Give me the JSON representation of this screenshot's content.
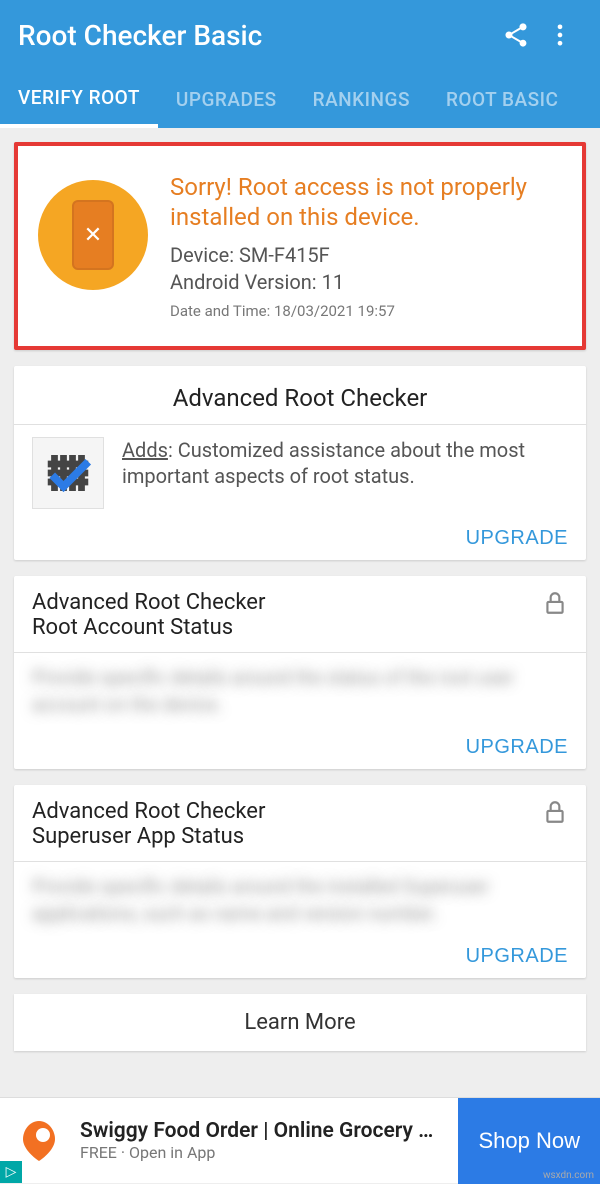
{
  "appbar": {
    "title": "Root Checker Basic"
  },
  "tabs": {
    "verify_root": "VERIFY ROOT",
    "upgrades": "UPGRADES",
    "rankings": "RANKINGS",
    "root_basics": "ROOT BASIC"
  },
  "status": {
    "headline": "Sorry! Root access is not properly installed on this device.",
    "device_label": "Device: SM-F415F",
    "android_label": "Android Version: 11",
    "datetime_label": "Date and Time: 18/03/2021 19:57"
  },
  "arc": {
    "title": "Advanced Root Checker",
    "adds_prefix": "Adds",
    "desc_rest": ": Customized assistance about the most important aspects of root status.",
    "upgrade": "UPGRADE"
  },
  "account_status": {
    "title1": "Advanced Root Checker",
    "title2": "Root Account Status",
    "blurred": "Provide specific details around the status of the root user account on the device.",
    "upgrade": "UPGRADE"
  },
  "superuser_status": {
    "title1": "Advanced Root Checker",
    "title2": "Superuser App Status",
    "blurred": "Provide specific details around the installed Superuser applications, such as name and version number.",
    "upgrade": "UPGRADE"
  },
  "learn_more": {
    "label": "Learn More"
  },
  "ad": {
    "title": "Swiggy Food Order | Online Grocery …",
    "subtitle": "FREE · Open in App",
    "button": "Shop Now"
  },
  "watermark": "wsxdn.com"
}
